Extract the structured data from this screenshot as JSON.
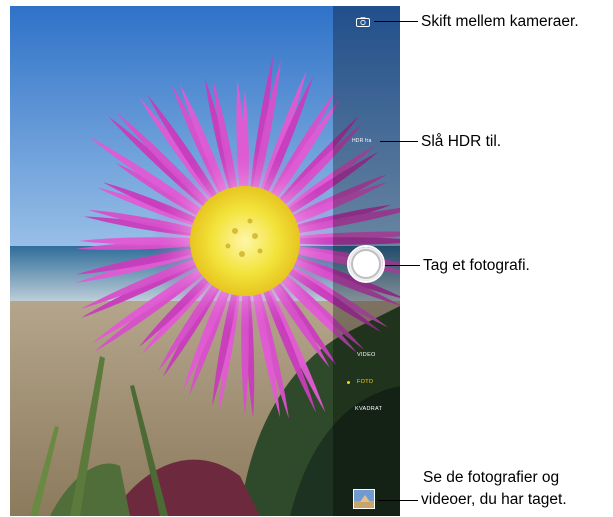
{
  "camera": {
    "hdr_label": "HDR fra",
    "modes": [
      "VIDEO",
      "FOTO",
      "KVADRAT"
    ],
    "active_mode": "FOTO",
    "switch_icon": "camera-switch-icon"
  },
  "callouts": {
    "switch_camera": "Skift mellem kameraer.",
    "hdr": "Slå HDR til.",
    "shutter": "Tag et fotografi.",
    "library_line1": "Se de fotografier og",
    "library_line2": "videoer, du har taget."
  },
  "colors": {
    "active_mode": "#ffd60a",
    "flower": "#d63fc4",
    "flower_center": "#f2e33a",
    "sky": "#3d7fc9"
  }
}
